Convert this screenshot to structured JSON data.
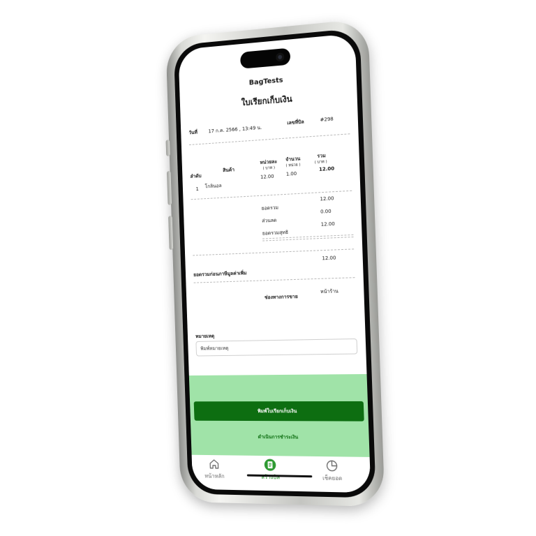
{
  "app_title": "BagTests",
  "doc_title": "ใบเรียกเก็บเงิน",
  "meta": {
    "date_label": "วันที่",
    "date_value": "17 ก.ค. 2566 , 13:49 น.",
    "bill_no_label": "เลขที่บิล",
    "bill_no_value": "#298"
  },
  "table": {
    "headers": {
      "no": "ลำดับ",
      "item": "สินค้า",
      "unit_price": "หน่วยละ",
      "unit_price_sub": "( บาท )",
      "qty": "จำนวน",
      "qty_sub": "( หน่วย )",
      "total": "รวม",
      "total_sub": "( บาท )"
    },
    "rows": [
      {
        "no": "1",
        "item": "โกลินอล",
        "unit_price": "12.00",
        "qty": "1.00",
        "total": "12.00"
      }
    ]
  },
  "summary": {
    "subtotal_label": "ยอดรวม",
    "subtotal_value": "12.00",
    "discount_label": "ส่วนลด",
    "discount_value": "0.00",
    "net_label": "ยอดรวมสุทธิ",
    "net_value": "12.00",
    "pre_vat_label": "ยอดรวมก่อนภาษีมูลค่าเพิ่ม",
    "pre_vat_value": "12.00"
  },
  "channel": {
    "label": "ช่องทางการขาย",
    "value": "หน้าร้าน"
  },
  "note": {
    "label": "หมายเหตุ",
    "placeholder": "พิมพ์หมายเหตุ"
  },
  "actions": {
    "print_label": "พิมพ์ใบเรียกเก็บเงิน",
    "pay_label": "ดำเนินการชำระเงิน"
  },
  "tabs": [
    {
      "label": "หน้าหลัก",
      "icon": "home-icon"
    },
    {
      "label": "สร้างบิล",
      "icon": "document-icon"
    },
    {
      "label": "เช็คยอด",
      "icon": "pie-chart-icon"
    }
  ],
  "colors": {
    "primary_green": "#0d6e11",
    "light_green": "#a0e3a8",
    "active_tab": "#1a8a1f"
  }
}
